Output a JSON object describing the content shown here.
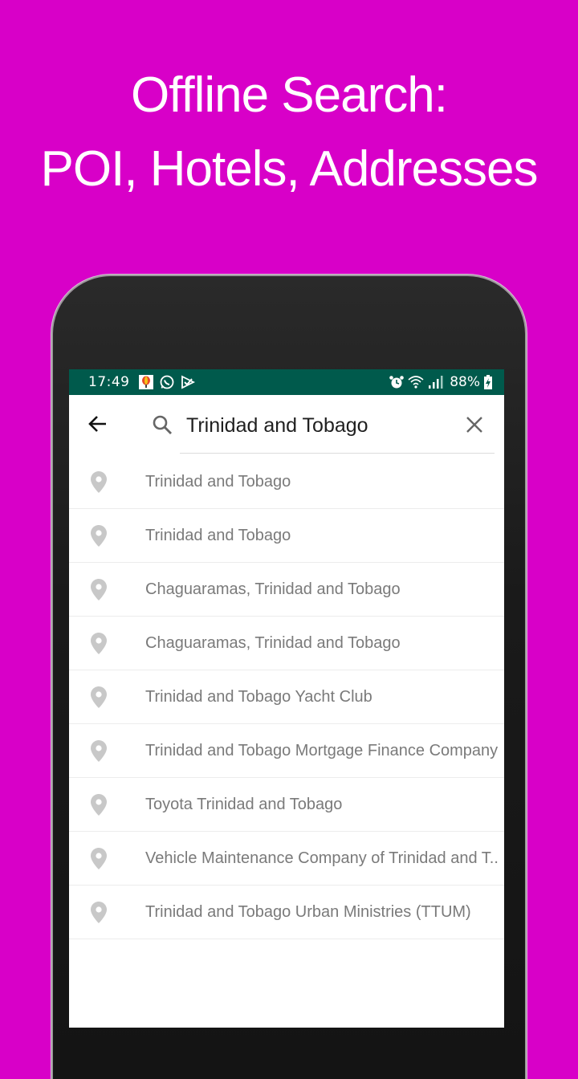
{
  "banner": {
    "line1": "Offline Search:",
    "line2": "POI, Hotels, Addresses",
    "background_color": "#d800c8"
  },
  "status_bar": {
    "time": "17:49",
    "left_icons": [
      "app-notification-icon",
      "whatsapp-icon",
      "play-check-icon"
    ],
    "right_icons": [
      "alarm-icon",
      "wifi-icon",
      "signal-icon"
    ],
    "battery_percent": "88%",
    "battery_icon": "battery-charging-icon",
    "background_color": "#005a4c"
  },
  "search": {
    "back_icon": "arrow-back-icon",
    "search_icon": "search-icon",
    "query": "Trinidad and Tobago",
    "clear_icon": "close-icon"
  },
  "results": [
    {
      "label": "Trinidad and Tobago",
      "icon": "map-pin-icon"
    },
    {
      "label": "Trinidad and Tobago",
      "icon": "map-pin-icon"
    },
    {
      "label": "Chaguaramas, Trinidad and Tobago",
      "icon": "map-pin-icon"
    },
    {
      "label": "Chaguaramas, Trinidad and Tobago",
      "icon": "map-pin-icon"
    },
    {
      "label": "Trinidad and Tobago Yacht Club",
      "icon": "map-pin-icon"
    },
    {
      "label": "Trinidad and Tobago Mortgage Finance Company",
      "icon": "map-pin-icon"
    },
    {
      "label": "Toyota Trinidad and Tobago",
      "icon": "map-pin-icon"
    },
    {
      "label": "Vehicle Maintenance Company of Trinidad and T..",
      "icon": "map-pin-icon"
    },
    {
      "label": "Trinidad and Tobago Urban Ministries (TTUM)",
      "icon": "map-pin-icon"
    }
  ]
}
